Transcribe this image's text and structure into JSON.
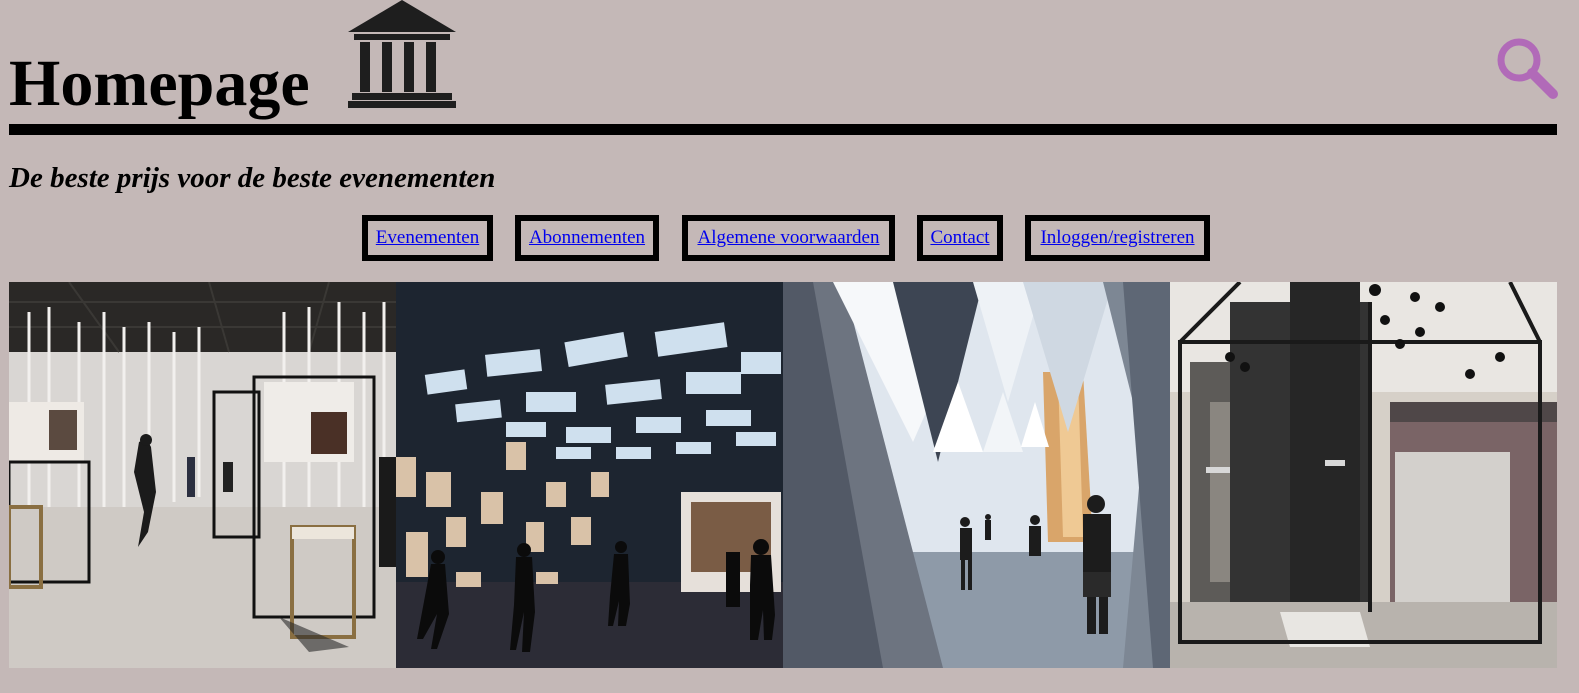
{
  "header": {
    "title": "Homepage",
    "tagline": "De beste prijs voor de beste evenementen",
    "logo_icon": "museum-icon",
    "search_icon": "search-icon",
    "search_color": "#b16ab8"
  },
  "nav": {
    "items": [
      {
        "label": "Evenementen"
      },
      {
        "label": "Abonnementen"
      },
      {
        "label": "Algemene voorwaarden"
      },
      {
        "label": "Contact"
      },
      {
        "label": "Inloggen/registreren"
      }
    ]
  },
  "gallery": {
    "photos": [
      {
        "subject": "exhibition-hall-white-poles"
      },
      {
        "subject": "exhibition-hall-lightbox-ceiling"
      },
      {
        "subject": "exhibition-white-triangular-panels"
      },
      {
        "subject": "showroom-black-frame-booth"
      }
    ]
  },
  "colors": {
    "background": "#c4b8b7",
    "link": "#0000ee",
    "border": "#000000"
  }
}
